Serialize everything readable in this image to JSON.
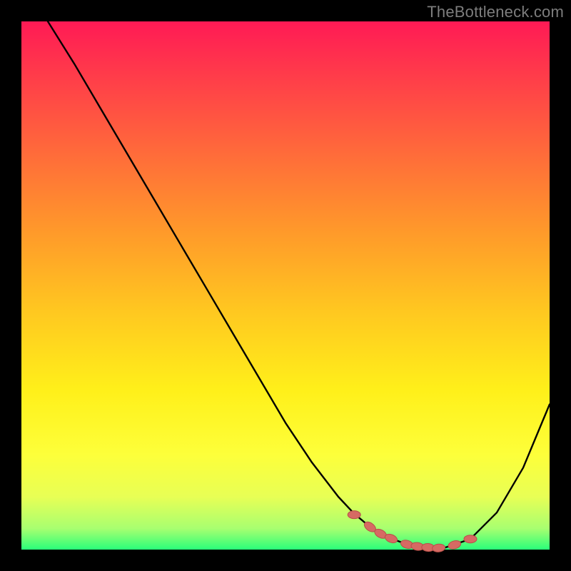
{
  "watermark": "TheBottleneck.com",
  "colors": {
    "curve_stroke": "#000000",
    "marker_fill": "#d66a63",
    "marker_stroke": "#b84f48"
  },
  "chart_data": {
    "type": "line",
    "title": "",
    "xlabel": "",
    "ylabel": "",
    "xlim": [
      0,
      100
    ],
    "ylim": [
      0,
      100
    ],
    "grid": false,
    "curve": {
      "x": [
        5,
        10,
        15,
        20,
        25,
        30,
        35,
        40,
        45,
        50,
        55,
        60,
        63,
        66,
        70,
        73,
        76,
        80,
        85,
        90,
        95,
        100
      ],
      "y": [
        100,
        92,
        83.5,
        75,
        66.5,
        58,
        49.5,
        41,
        32.5,
        24,
        16.5,
        10,
        6.8,
        4.3,
        2.1,
        1.0,
        0.4,
        0.3,
        2.0,
        7.0,
        15.5,
        27.5
      ]
    },
    "markers": {
      "x": [
        63,
        66,
        68,
        70,
        73,
        75,
        77,
        79,
        82,
        85
      ],
      "y": [
        6.6,
        4.3,
        3.0,
        2.1,
        1.0,
        0.6,
        0.4,
        0.3,
        0.9,
        2.0
      ]
    }
  }
}
